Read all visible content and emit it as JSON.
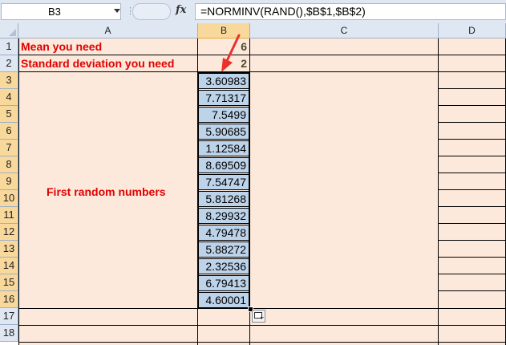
{
  "formula_bar": {
    "name_box": "B3",
    "fx_label": "fx",
    "formula": "=NORMINV(RAND(),$B$1,$B$2)"
  },
  "columns": [
    "A",
    "B",
    "C",
    "D"
  ],
  "rows": [
    "1",
    "2",
    "3",
    "4",
    "5",
    "6",
    "7",
    "8",
    "9",
    "10",
    "11",
    "12",
    "13",
    "14",
    "15",
    "16",
    "17",
    "18"
  ],
  "cells": {
    "A1": "Mean you need",
    "B1": "6",
    "A2": "Standard deviation you need",
    "B2": "2",
    "A_merged_label": "First random numbers",
    "B_values": [
      "3.60983",
      "7.71317",
      "7.5499",
      "5.90685",
      "1.12584",
      "8.69509",
      "7.54747",
      "5.81268",
      "8.29932",
      "4.79478",
      "5.88272",
      "2.32536",
      "6.79413",
      "4.60001"
    ]
  },
  "colors": {
    "cell_background": "#fde9db",
    "selected_range": "#bdd3ea",
    "label_text": "#e00000",
    "arrow": "#e8322b",
    "header_selected": "#f9d99b"
  },
  "icons": {
    "name_box_dropdown": "chevron-down-icon",
    "autofill_options": "autofill-options-icon",
    "annotation_arrow": "red-arrow-icon"
  }
}
